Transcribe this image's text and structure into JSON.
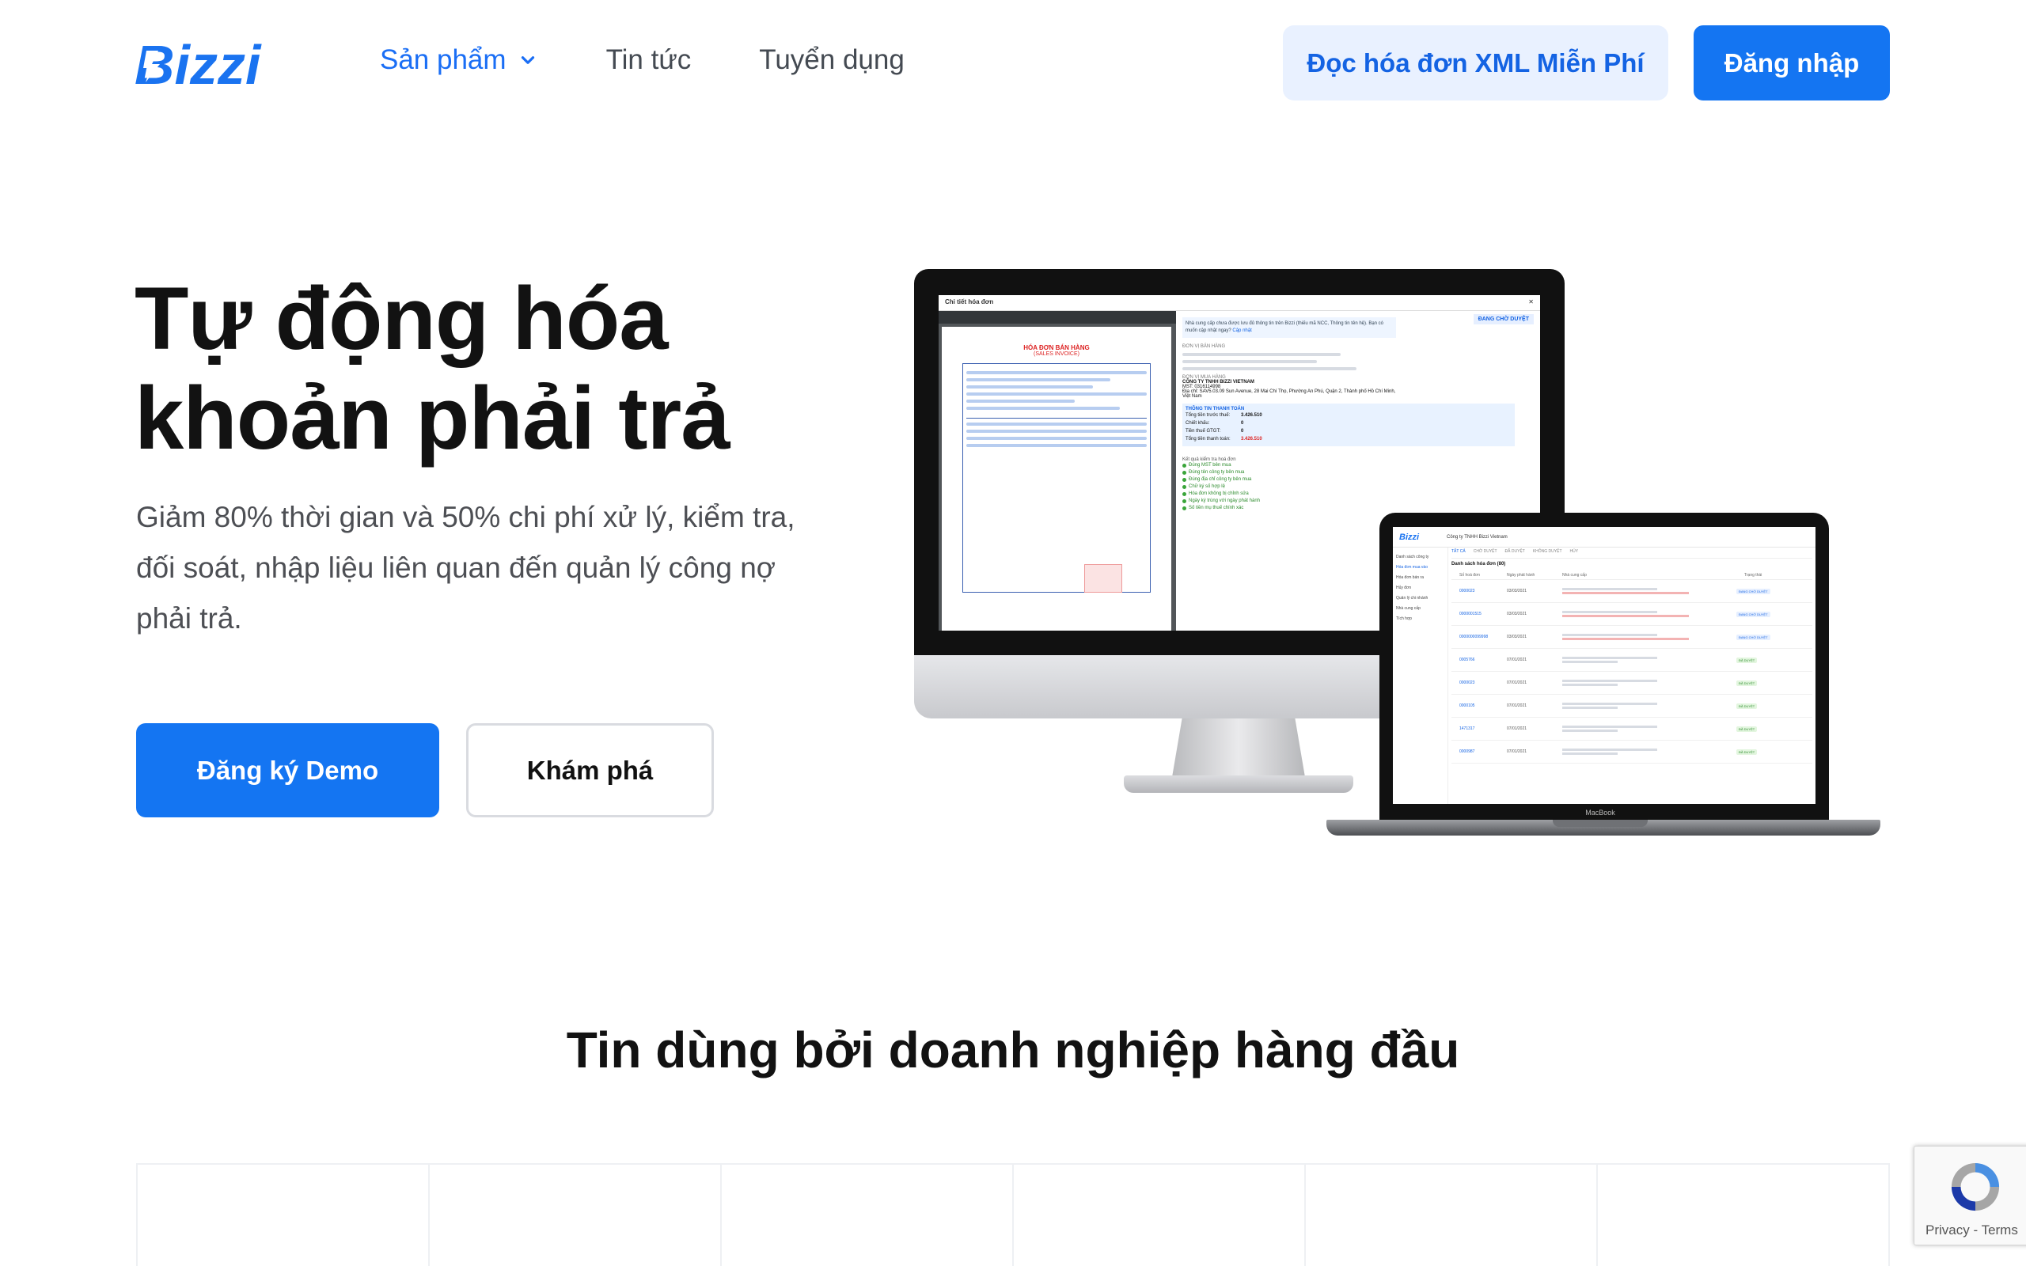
{
  "header": {
    "logo_text": "Bizzi",
    "nav": [
      {
        "label": "Sản phẩm",
        "active": true,
        "has_dropdown": true
      },
      {
        "label": "Tin tức",
        "active": false
      },
      {
        "label": "Tuyển dụng",
        "active": false
      }
    ],
    "xml_button": "Đọc hóa đơn XML Miễn Phí",
    "login_button": "Đăng nhập"
  },
  "hero": {
    "title_line1": "Tự động hóa",
    "title_line2": "khoản phải trả",
    "subtitle": "Giảm 80% thời gian và 50% chi phí xử lý, kiểm tra, đối soát, nhập liệu liên quan đến quản lý công nợ phải trả.",
    "demo_button": "Đăng ký Demo",
    "explore_button": "Khám phá"
  },
  "imac_app": {
    "window_title": "Chi tiết hóa đơn",
    "invoice_heading": "HÓA ĐƠN BÁN HÀNG",
    "invoice_subheading": "(SALES INVOICE)",
    "status_badge": "ĐANG CHỜ DUYỆT",
    "notice": "Nhà cung cấp chưa được lưu đủ thông tin trên Bizzi (thiếu mã NCC, Thông tin tên hệ). Bạn có muốn cập nhật ngay?",
    "notice_action": "Cập nhật",
    "seller_label": "ĐƠN VỊ BÁN HÀNG",
    "buyer_label": "ĐƠN VỊ MUA HÀNG",
    "buyer_name": "CÔNG TY TNHH BIZZI VIETNAM",
    "buyer_tax": "MST: 0316114998",
    "buyer_address": "Địa chỉ: SAV5.03.09 Sun Avenue, 28 Mai Chí Thọ, Phường An Phú, Quận 2, Thành phố Hồ Chí Minh, Việt Nam",
    "payment_section": "THÔNG TIN THANH TOÁN",
    "payment_rows": [
      {
        "label": "Tổng tiền trước thuế:",
        "value": "3.426.510"
      },
      {
        "label": "Chiết khấu:",
        "value": "0"
      },
      {
        "label": "Tiền thuế GTGT:",
        "value": "0"
      },
      {
        "label": "Tổng tiền thanh toán:",
        "value": "3.426.510"
      }
    ],
    "check_title": "Kết quả kiểm tra hoá đơn",
    "checks": [
      "Đúng MST bên mua",
      "Đúng tên công ty bên mua",
      "Đúng địa chỉ công ty bên mua",
      "Chữ ký số hợp lệ",
      "Hóa đơn không bị chỉnh sửa",
      "Ngày ký trùng với ngày phát hành",
      "Số tiền mụ thuế chính xác"
    ]
  },
  "macbook_app": {
    "logo_text": "Bizzi",
    "company": "Công ty TNHH Bizzi Vietnam",
    "list_title": "Danh sách hóa đơn (80)",
    "tabs": [
      "TẤT CẢ",
      "CHỜ DUYỆT",
      "ĐÃ DUYỆT",
      "KHÔNG DUYỆT",
      "HỦY"
    ],
    "sidebar": [
      "Danh sách công ty",
      "Hóa đơn mua vào",
      "Hóa đơn bán ra",
      "Hủy đơn",
      "Quản lý chi nhánh",
      "Nhà cung cấp",
      "Tích hợp"
    ],
    "columns": [
      "Số hoá đơn",
      "Ngày phát hành",
      "Nhà cung cấp",
      "Trạng thái"
    ],
    "rows": [
      {
        "number": "0000023",
        "date": "03/03/2021",
        "status": "ĐANG CHỜ DUYỆT"
      },
      {
        "number": "0000001515",
        "date": "03/03/2021",
        "status": "ĐANG CHỜ DUYỆT"
      },
      {
        "number": "0000000099998",
        "date": "03/03/2021",
        "status": "ĐANG CHỜ DUYỆT"
      },
      {
        "number": "0005766",
        "date": "07/01/2021",
        "status": "ĐÃ DUYỆT"
      },
      {
        "number": "0000023",
        "date": "07/01/2021",
        "status": "ĐÃ DUYỆT"
      },
      {
        "number": "0000105",
        "date": "07/01/2021",
        "status": "ĐÃ DUYỆT"
      },
      {
        "number": "1471317",
        "date": "07/01/2021",
        "status": "ĐÃ DUYỆT"
      },
      {
        "number": "0000987",
        "date": "07/01/2021",
        "status": "ĐÃ DUYỆT"
      }
    ],
    "device_label": "MacBook"
  },
  "trust": {
    "title": "Tin dùng bởi doanh nghiệp hàng đầu"
  },
  "recaptcha": {
    "privacy": "Privacy",
    "separator": "-",
    "terms": "Terms"
  },
  "colors": {
    "brand_blue": "#1475f2",
    "light_blue_bg": "#e9f1ff",
    "text_dark": "#121212",
    "text_muted": "#4d4f54"
  }
}
